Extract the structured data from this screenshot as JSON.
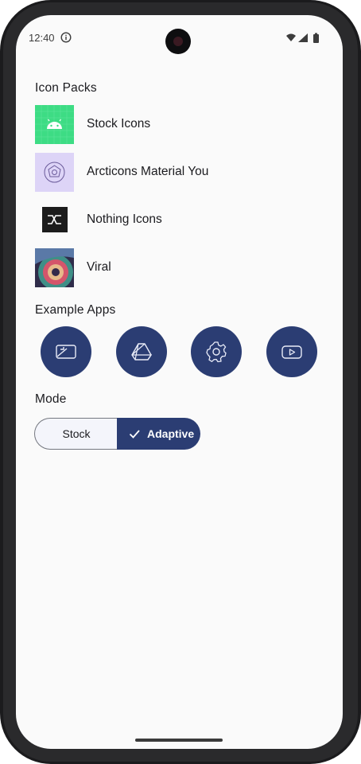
{
  "status_bar": {
    "time": "12:40",
    "icons": [
      "info-icon",
      "wifi-icon",
      "signal-icon",
      "battery-icon"
    ]
  },
  "icon_packs": {
    "title": "Icon Packs",
    "items": [
      {
        "label": "Stock Icons",
        "icon": "android-icon"
      },
      {
        "label": "Arcticons Material You",
        "icon": "arcticons-icon"
      },
      {
        "label": "Nothing Icons",
        "icon": "nothing-icon"
      },
      {
        "label": "Viral",
        "icon": "viral-icon"
      }
    ]
  },
  "example_apps": {
    "title": "Example Apps",
    "items": [
      {
        "icon": "gallery-icon"
      },
      {
        "icon": "drive-icon"
      },
      {
        "icon": "settings-gear-icon"
      },
      {
        "icon": "youtube-icon"
      }
    ]
  },
  "mode": {
    "title": "Mode",
    "options": [
      "Stock",
      "Adaptive"
    ],
    "selected": "Adaptive"
  },
  "colors": {
    "accent": "#2b3d73",
    "background": "#fafafa",
    "text": "#1b1b1f"
  }
}
